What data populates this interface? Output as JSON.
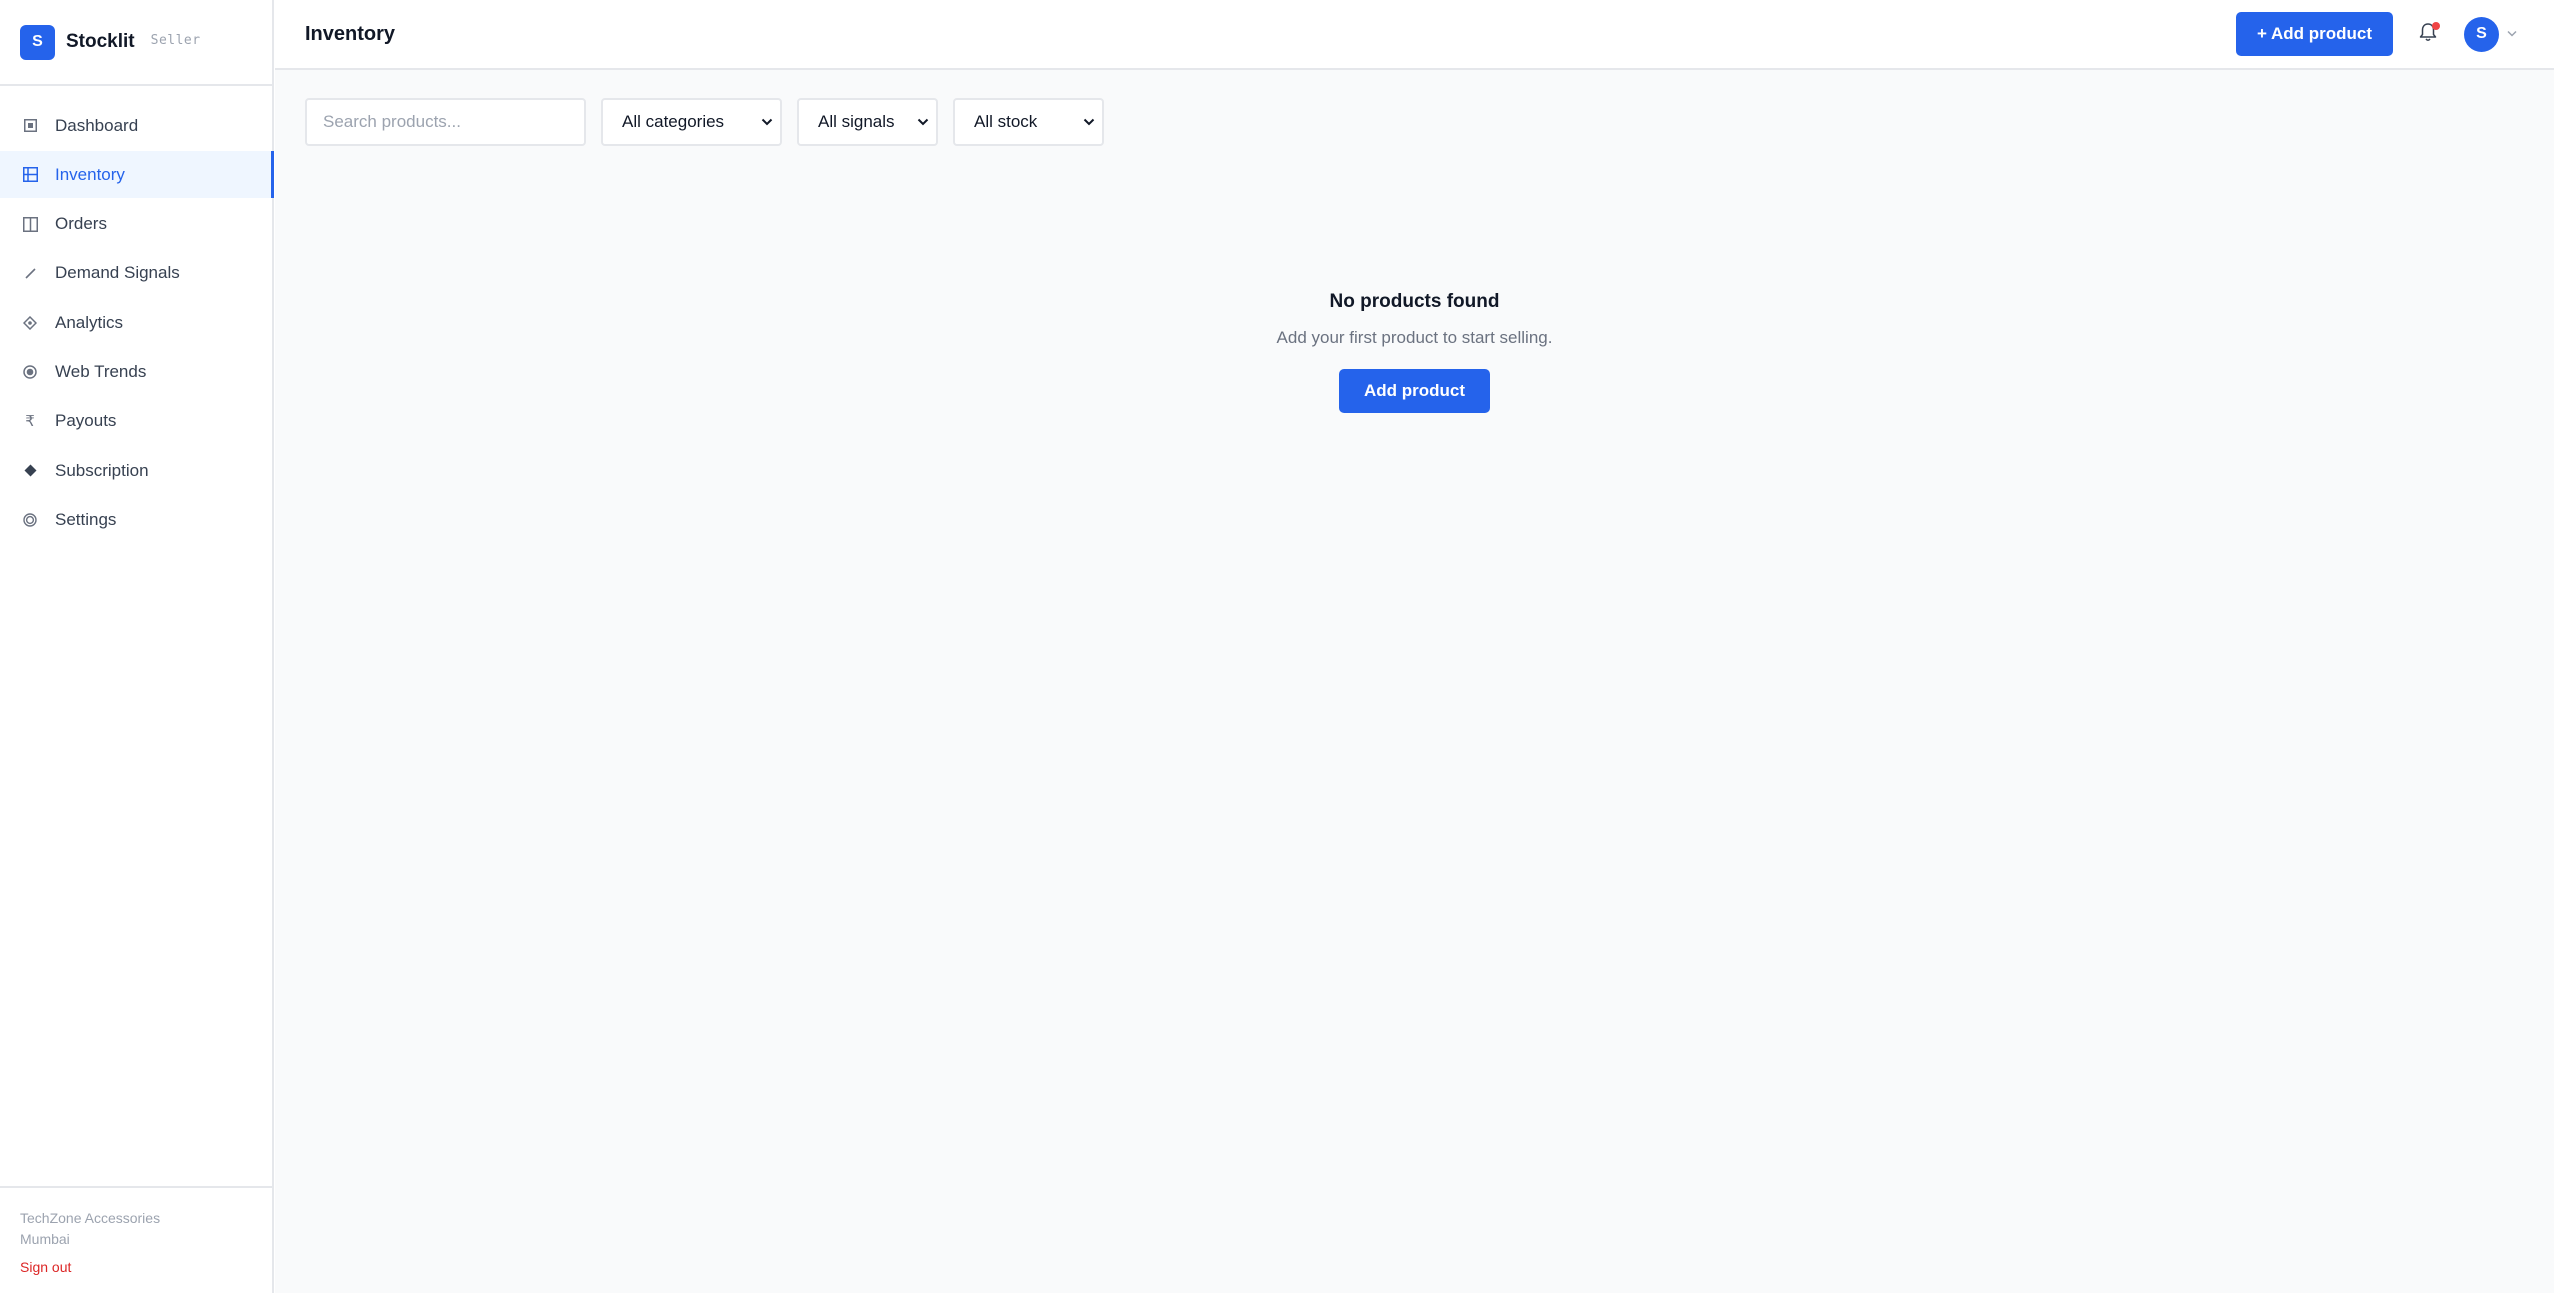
{
  "brand": {
    "logo_letter": "S",
    "name": "Stocklit",
    "role": "Seller"
  },
  "sidebar": {
    "items": [
      {
        "label": "Dashboard",
        "icon": "square-dot-icon"
      },
      {
        "label": "Inventory",
        "icon": "inventory-grid-icon",
        "active": true
      },
      {
        "label": "Orders",
        "icon": "orders-columns-icon"
      },
      {
        "label": "Demand Signals",
        "icon": "trend-arrow-icon"
      },
      {
        "label": "Analytics",
        "icon": "diamond-outline-icon"
      },
      {
        "label": "Web Trends",
        "icon": "radio-dot-icon"
      },
      {
        "label": "Payouts",
        "icon": "rupee-icon"
      },
      {
        "label": "Subscription",
        "icon": "diamond-filled-icon"
      },
      {
        "label": "Settings",
        "icon": "settings-ring-icon"
      }
    ],
    "footer": {
      "store_name": "TechZone Accessories",
      "store_city": "Mumbai",
      "signout_label": "Sign out"
    }
  },
  "header": {
    "title": "Inventory",
    "add_product_label": "+ Add product",
    "avatar_letter": "S",
    "notification_dot": true
  },
  "filters": {
    "search_placeholder": "Search products...",
    "category_selected": "All categories",
    "signal_selected": "All signals",
    "stock_selected": "All stock"
  },
  "empty_state": {
    "title": "No products found",
    "subtitle": "Add your first product to start selling.",
    "button_label": "Add product"
  },
  "colors": {
    "accent": "#2563eb",
    "danger": "#dc2626",
    "notification": "#ef4444",
    "background": "#f9fafb"
  }
}
